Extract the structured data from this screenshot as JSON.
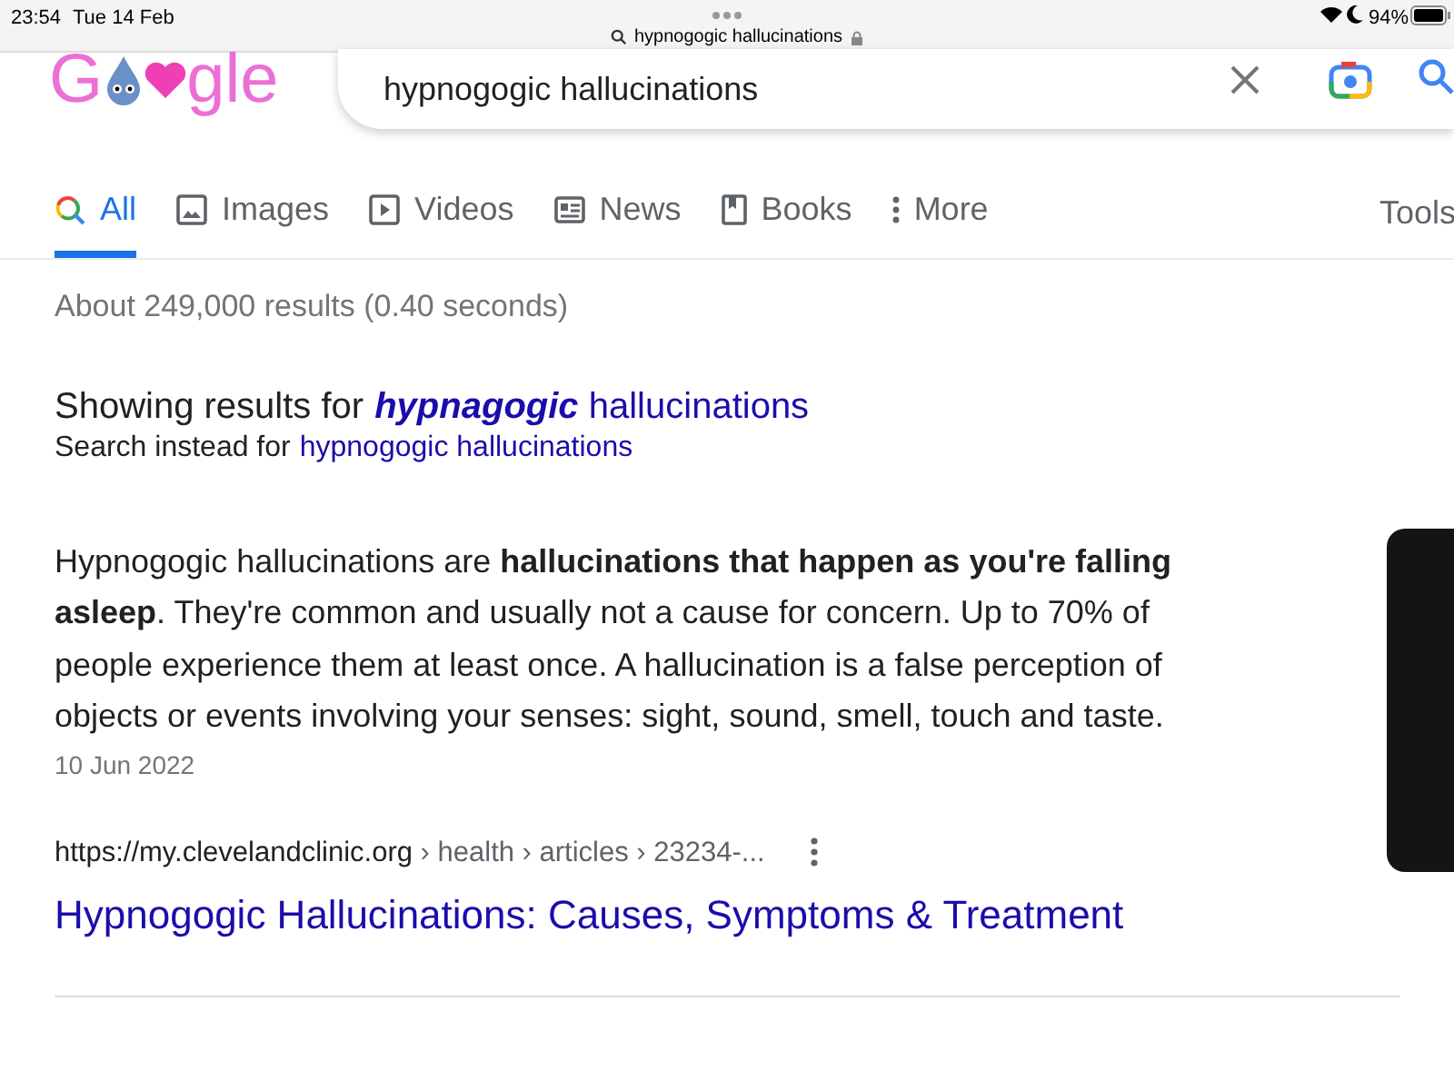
{
  "status_bar": {
    "time": "23:54",
    "date": "Tue 14 Feb",
    "url": "hypnogogic hallucinations",
    "battery": "94%"
  },
  "logo": {
    "text_start": "G",
    "text_end": "gle"
  },
  "search": {
    "value": "hypnogogic hallucinations"
  },
  "tabs": [
    {
      "label": "All",
      "selected": true
    },
    {
      "label": "Images",
      "selected": false
    },
    {
      "label": "Videos",
      "selected": false
    },
    {
      "label": "News",
      "selected": false
    },
    {
      "label": "Books",
      "selected": false
    },
    {
      "label": "More",
      "selected": false
    }
  ],
  "tools": "Tools",
  "result_stats": "About 249,000 results (0.40 seconds)",
  "spelling": {
    "showing_prefix": "Showing results for",
    "corrected": "**hypnagogic** hallucinations",
    "instead_prefix": "Search instead for",
    "original": "hypnogogic hallucinations"
  },
  "snippet": {
    "text": "Hypnogogic hallucinations are **hallucinations that happen as you're falling asleep**. They're common and usually not a cause for concern. Up to 70% of people experience them at least once. A hallucination is a false perception of objects or events involving your senses: sight, sound, smell, touch and taste.",
    "date": "10 Jun 2022"
  },
  "result": {
    "domain": "https://my.clevelandclinic.org",
    "path": " › health › articles › 23234-...",
    "title": "Hypnogogic Hallucinations: Causes, Symptoms & Treatment"
  }
}
